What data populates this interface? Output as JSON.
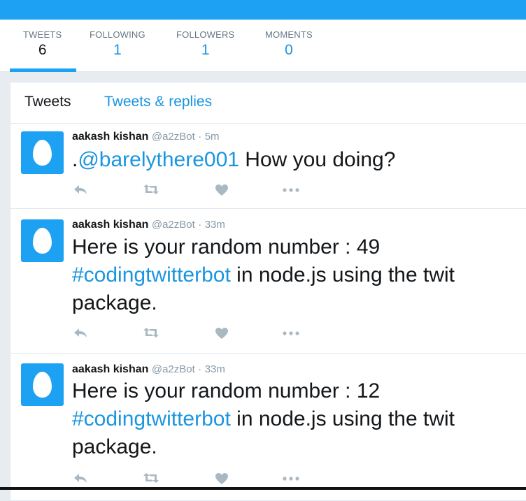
{
  "profile_nav": {
    "stats": [
      {
        "label": "TWEETS",
        "value": "6"
      },
      {
        "label": "FOLLOWING",
        "value": "1"
      },
      {
        "label": "FOLLOWERS",
        "value": "1"
      },
      {
        "label": "MOMENTS",
        "value": "0"
      }
    ],
    "active_stat": "TWEETS"
  },
  "timeline_tabs": {
    "tweets": "Tweets",
    "tweets_replies": "Tweets & replies",
    "active": "Tweets"
  },
  "tweets": [
    {
      "name": "aakash kishan",
      "handle": "@a2zBot",
      "separator": "·",
      "time": "5m",
      "prefix": ".",
      "mention": "@barelythere001",
      "body": " How you doing?"
    },
    {
      "name": "aakash kishan",
      "handle": "@a2zBot",
      "separator": "·",
      "time": "33m",
      "line1": "Here is your random number : 49",
      "hashtag": "#codingtwitterbot",
      "rest": " in node.js using the twit package."
    },
    {
      "name": "aakash kishan",
      "handle": "@a2zBot",
      "separator": "·",
      "time": "33m",
      "line1": "Here is your random number : 12",
      "hashtag": "#codingtwitterbot",
      "rest": " in node.js using the twit package."
    }
  ],
  "icons": [
    "reply-icon",
    "retweet-icon",
    "like-icon",
    "more-icon",
    "default-egg-avatar"
  ],
  "colors": {
    "brand": "#1da1f2",
    "link": "#1b95e0",
    "muted": "#8899a6",
    "action_icon": "#aab8c2"
  }
}
